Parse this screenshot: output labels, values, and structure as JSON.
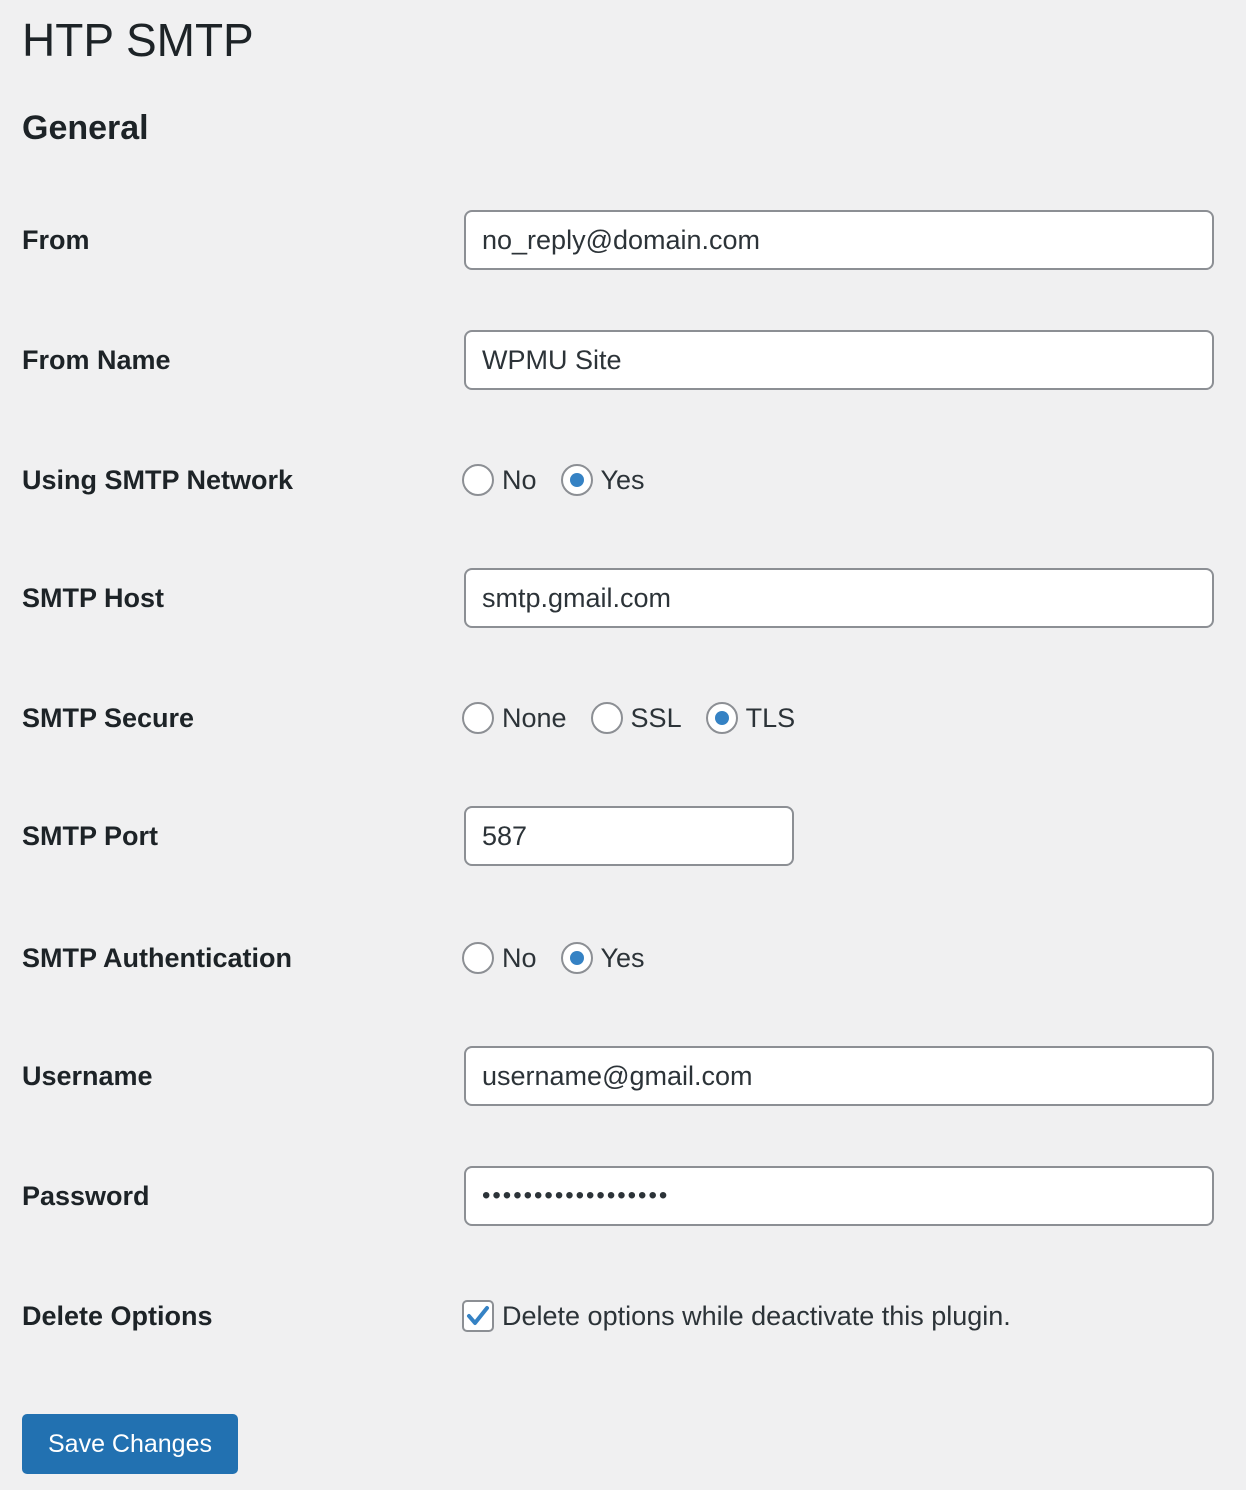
{
  "page": {
    "title": "HTP SMTP",
    "section": "General"
  },
  "fields": {
    "from": {
      "label": "From",
      "value": "no_reply@domain.com"
    },
    "from_name": {
      "label": "From Name",
      "value": "WPMU Site"
    },
    "smtp_network": {
      "label": "Using SMTP Network",
      "options": [
        "No",
        "Yes"
      ],
      "selected": "Yes"
    },
    "smtp_host": {
      "label": "SMTP Host",
      "value": "smtp.gmail.com"
    },
    "smtp_secure": {
      "label": "SMTP Secure",
      "options": [
        "None",
        "SSL",
        "TLS"
      ],
      "selected": "TLS"
    },
    "smtp_port": {
      "label": "SMTP Port",
      "value": "587"
    },
    "smtp_auth": {
      "label": "SMTP Authentication",
      "options": [
        "No",
        "Yes"
      ],
      "selected": "Yes"
    },
    "username": {
      "label": "Username",
      "value": "username@gmail.com"
    },
    "password": {
      "label": "Password",
      "value": "••••••••••••••••••"
    },
    "delete_options": {
      "label": "Delete Options",
      "checkbox_label": "Delete options while deactivate this plugin.",
      "checked": true
    }
  },
  "actions": {
    "save_label": "Save Changes"
  },
  "colors": {
    "accent": "#2271b1",
    "radio_dot": "#3582c4",
    "background": "#f0f0f1"
  }
}
